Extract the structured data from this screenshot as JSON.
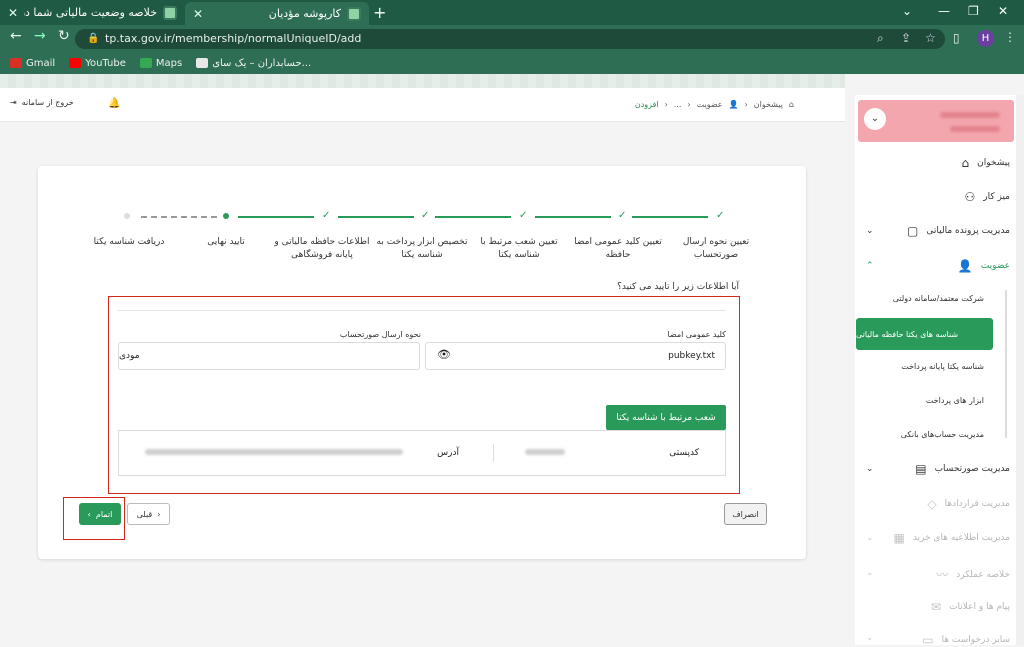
{
  "browser": {
    "tabs": [
      {
        "title": "خلاصه وضعیت مالیاتی شما در نظا"
      },
      {
        "title": "کارپوشه مؤدیان"
      }
    ],
    "url": "tp.tax.gov.ir/membership/normalUniqueID/add",
    "profile_initial": "H",
    "bookmarks": [
      {
        "label": "Gmail",
        "color": "#d93025"
      },
      {
        "label": "YouTube",
        "color": "#ff0000"
      },
      {
        "label": "Maps",
        "color": "#34a853"
      },
      {
        "label": "حسابداران – یک سای...",
        "color": "#e8e8e8"
      }
    ]
  },
  "topbar": {
    "logout": "خروج از سامانه"
  },
  "breadcrumb": {
    "home": "پیشخوان",
    "membership": "عضویت",
    "ellipsis": "...",
    "current": "افزودن"
  },
  "stepper": {
    "steps": [
      {
        "label": "تعیین نحوه ارسال صورتحساب",
        "state": "done"
      },
      {
        "label": "تعیین کلید عمومی امضا حافظه",
        "state": "done"
      },
      {
        "label": "تعیین شعب مرتبط با شناسه یکتا",
        "state": "done"
      },
      {
        "label": "تخصیص ابزار پرداخت به شناسه یکتا",
        "state": "done"
      },
      {
        "label": "اطلاعات حافظه مالیاتی و پایانه فروشگاهی",
        "state": "done"
      },
      {
        "label": "تایید نهایی",
        "state": "current"
      },
      {
        "label": "دریافت شناسه یکتا",
        "state": "pending"
      }
    ]
  },
  "form": {
    "question": "آیا اطلاعات زیر را تایید می کنید؟",
    "pubkey_label": "کلید عمومی امضا",
    "pubkey_value": "pubkey.txt",
    "send_label": "نحوه ارسال صورتحساب",
    "send_value": "مودی",
    "branches_header": "شعب مرتبط با شناسه یکتا",
    "branch": {
      "postal_label": "کدپستی",
      "address_label": "آدرس"
    }
  },
  "buttons": {
    "finish": "اتمام",
    "prev": "قبلی",
    "cancel": "انصراف"
  },
  "sidebar": {
    "items": [
      {
        "label": "پیشخوان",
        "icon": "home-icon"
      },
      {
        "label": "میز کار",
        "icon": "workspace-icon"
      },
      {
        "label": "مدیریت پرونده مالیاتی",
        "icon": "file-icon"
      },
      {
        "label": "عضویت",
        "icon": "user-icon"
      },
      {
        "label": "مدیریت صورتحساب",
        "icon": "invoice-icon"
      },
      {
        "label": "مدیریت قراردادها",
        "icon": "contract-icon"
      },
      {
        "label": "مدیریت اطلاعیه های خرید",
        "icon": "cart-icon"
      },
      {
        "label": "خلاصه عملکرد",
        "icon": "chart-icon"
      },
      {
        "label": "پیام ها و اعلانات",
        "icon": "message-icon"
      },
      {
        "label": "سایر درخواست ها",
        "icon": "request-icon"
      }
    ],
    "subitems": [
      {
        "label": "شرکت معتمد/سامانه دولتی"
      },
      {
        "label": "شناسه های یکتا حافظه مالیاتی"
      },
      {
        "label": "شناسه یکتا پایانه پرداخت"
      },
      {
        "label": "ابزار های پرداخت"
      },
      {
        "label": "مدیریت حساب‌های بانکی"
      }
    ]
  },
  "colors": {
    "accent": "#2a9a5a",
    "highlight": "#d3261f",
    "browser": "#2d6e55"
  }
}
